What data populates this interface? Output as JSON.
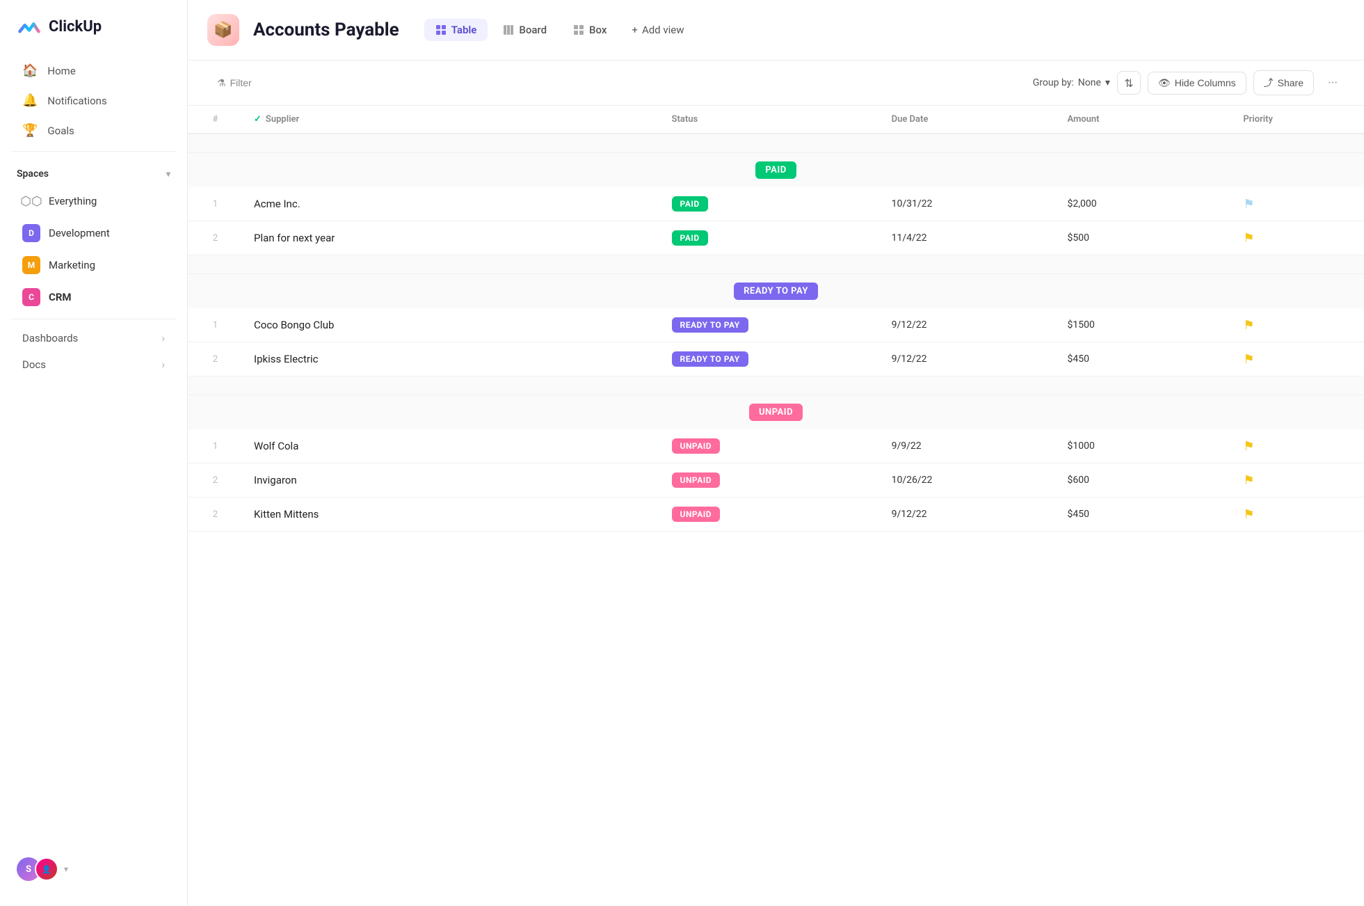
{
  "logo": {
    "text": "ClickUp"
  },
  "sidebar": {
    "nav": [
      {
        "id": "home",
        "label": "Home",
        "icon": "🏠"
      },
      {
        "id": "notifications",
        "label": "Notifications",
        "icon": "🔔"
      },
      {
        "id": "goals",
        "label": "Goals",
        "icon": "🏆"
      }
    ],
    "spaces_header": "Spaces",
    "spaces": [
      {
        "id": "everything",
        "label": "Everything",
        "type": "everything"
      },
      {
        "id": "development",
        "label": "Development",
        "type": "badge",
        "color": "#7b68ee",
        "letter": "D"
      },
      {
        "id": "marketing",
        "label": "Marketing",
        "type": "badge",
        "color": "#f59e0b",
        "letter": "M"
      },
      {
        "id": "crm",
        "label": "CRM",
        "type": "badge",
        "color": "#ec4899",
        "letter": "C",
        "bold": true
      }
    ],
    "collapse_items": [
      {
        "id": "dashboards",
        "label": "Dashboards"
      },
      {
        "id": "docs",
        "label": "Docs"
      }
    ]
  },
  "header": {
    "page_title": "Accounts Payable",
    "views": [
      {
        "id": "table",
        "label": "Table",
        "active": true
      },
      {
        "id": "board",
        "label": "Board",
        "active": false
      },
      {
        "id": "box",
        "label": "Box",
        "active": false
      }
    ],
    "add_view_label": "Add view"
  },
  "toolbar": {
    "filter_label": "Filter",
    "group_by_label": "Group by:",
    "group_by_value": "None",
    "hide_columns_label": "Hide Columns",
    "share_label": "Share"
  },
  "table": {
    "columns": [
      {
        "id": "num",
        "label": "#"
      },
      {
        "id": "supplier",
        "label": "Supplier"
      },
      {
        "id": "status",
        "label": "Status"
      },
      {
        "id": "due_date",
        "label": "Due Date"
      },
      {
        "id": "amount",
        "label": "Amount"
      },
      {
        "id": "priority",
        "label": "Priority"
      }
    ],
    "groups": [
      {
        "id": "paid",
        "label": "PAID",
        "type": "paid",
        "rows": [
          {
            "num": "1",
            "supplier": "Acme Inc.",
            "status": "PAID",
            "status_type": "paid",
            "due_date": "10/31/22",
            "amount": "$2,000",
            "priority": "blue"
          },
          {
            "num": "2",
            "supplier": "Plan for next year",
            "status": "PAID",
            "status_type": "paid",
            "due_date": "11/4/22",
            "amount": "$500",
            "priority": "yellow"
          }
        ]
      },
      {
        "id": "ready",
        "label": "READY TO PAY",
        "type": "ready",
        "rows": [
          {
            "num": "1",
            "supplier": "Coco Bongo Club",
            "status": "READY TO PAY",
            "status_type": "ready",
            "due_date": "9/12/22",
            "amount": "$1500",
            "priority": "yellow"
          },
          {
            "num": "2",
            "supplier": "Ipkiss Electric",
            "status": "READY TO PAY",
            "status_type": "ready",
            "due_date": "9/12/22",
            "amount": "$450",
            "priority": "yellow"
          }
        ]
      },
      {
        "id": "unpaid",
        "label": "UNPAID",
        "type": "unpaid",
        "rows": [
          {
            "num": "1",
            "supplier": "Wolf Cola",
            "status": "UNPAID",
            "status_type": "unpaid",
            "due_date": "9/9/22",
            "amount": "$1000",
            "priority": "yellow"
          },
          {
            "num": "2",
            "supplier": "Invigaron",
            "status": "UNPAID",
            "status_type": "unpaid",
            "due_date": "10/26/22",
            "amount": "$600",
            "priority": "yellow"
          },
          {
            "num": "2",
            "supplier": "Kitten Mittens",
            "status": "UNPAID",
            "status_type": "unpaid",
            "due_date": "9/12/22",
            "amount": "$450",
            "priority": "yellow"
          }
        ]
      }
    ]
  }
}
